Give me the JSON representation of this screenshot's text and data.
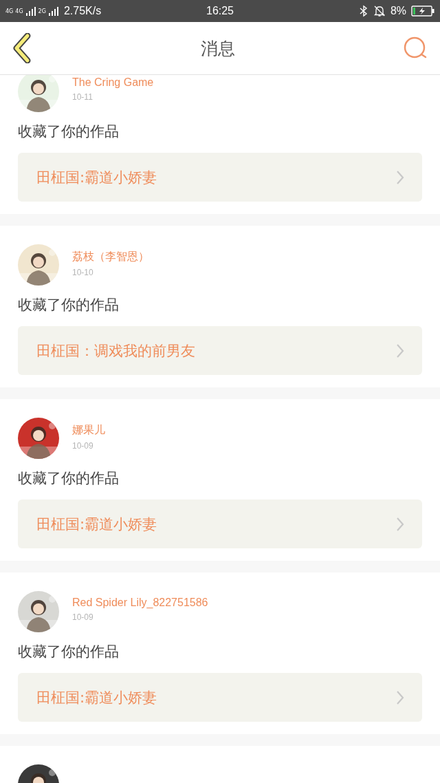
{
  "status_bar": {
    "network_labels": [
      "4G",
      "4G",
      "2G"
    ],
    "speed": "2.75K/s",
    "time": "16:25",
    "battery": "8%"
  },
  "header": {
    "title": "消息"
  },
  "notifications": [
    {
      "kind": "full",
      "name": "The Cring Game",
      "date": "10-11",
      "action": "收藏了你的作品",
      "work": "田柾国:霸道小娇妻",
      "color": "#e9f3e6"
    },
    {
      "kind": "full",
      "name": "荔枝（李智恩）",
      "date": "10-10",
      "action": "收藏了你的作品",
      "work": "田柾国：调戏我的前男友",
      "color": "#f1e6cf"
    },
    {
      "kind": "full",
      "name": "娜果儿",
      "date": "10-09",
      "action": "收藏了你的作品",
      "work": "田柾国:霸道小娇妻",
      "color": "#c9322b"
    },
    {
      "kind": "full",
      "name": "Red Spider Lily_822751586",
      "date": "10-09",
      "action": "收藏了你的作品",
      "work": "田柾国:霸道小娇妻",
      "color": "#d8d8d4"
    },
    {
      "kind": "peek",
      "color": "#3a3a3a"
    }
  ]
}
